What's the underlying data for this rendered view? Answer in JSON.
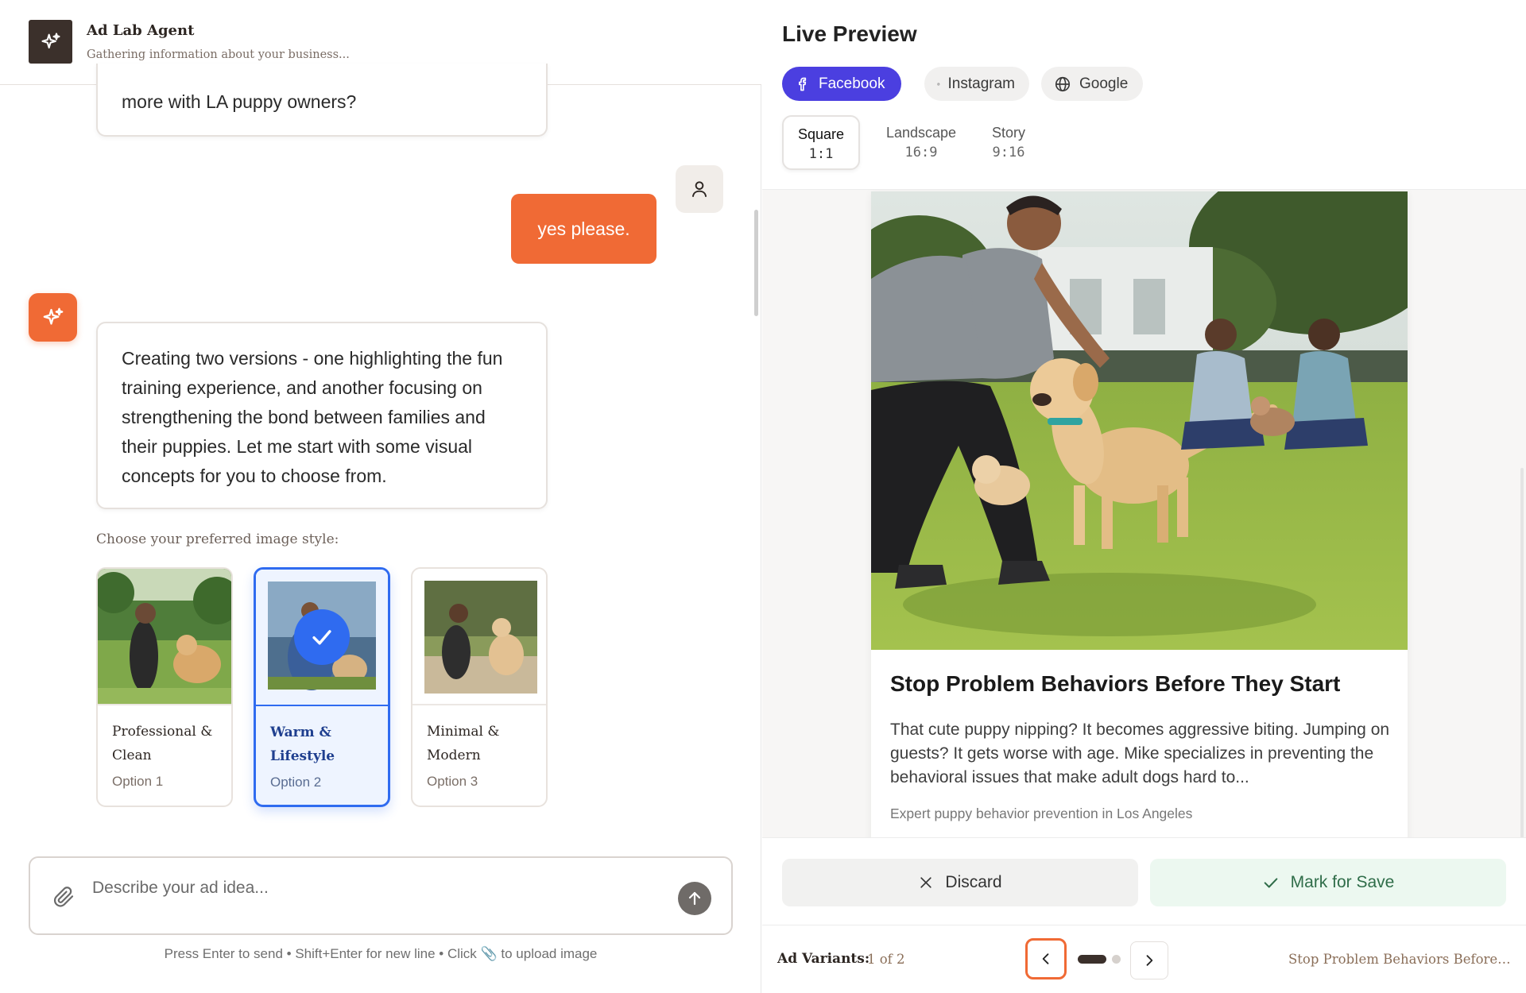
{
  "agent": {
    "name": "Ad Lab Agent",
    "status": "Gathering information about your business..."
  },
  "chat": {
    "messages": [
      {
        "role": "assistant",
        "text": "more with LA puppy owners?"
      },
      {
        "role": "user",
        "text": "yes please."
      },
      {
        "role": "assistant",
        "text": "Creating two versions - one highlighting the fun training experience, and another focusing on strengthening the bond between families and their puppies. Let me start with some visual concepts for you to choose from."
      }
    ],
    "style_prompt": "Choose your preferred image style:",
    "style_options": [
      {
        "title": "Professional & Clean",
        "subtitle": "Option 1",
        "selected": false
      },
      {
        "title": "Warm & Lifestyle",
        "subtitle": "Option 2",
        "selected": true
      },
      {
        "title": "Minimal & Modern",
        "subtitle": "Option 3",
        "selected": false
      }
    ]
  },
  "composer": {
    "placeholder": "Describe your ad idea...",
    "hint": "Press Enter to send • Shift+Enter for new line • Click 📎 to upload image"
  },
  "preview": {
    "title": "Live Preview",
    "platforms": [
      {
        "label": "Facebook",
        "icon": "facebook-icon",
        "active": true
      },
      {
        "label": "Instagram",
        "icon": "instagram-icon",
        "active": false
      },
      {
        "label": "Google",
        "icon": "globe-icon",
        "active": false
      }
    ],
    "formats": [
      {
        "name": "Square",
        "ratio": "1:1",
        "active": true
      },
      {
        "name": "Landscape",
        "ratio": "16:9",
        "active": false
      },
      {
        "name": "Story",
        "ratio": "9:16",
        "active": false
      }
    ],
    "ad": {
      "headline": "Stop Problem Behaviors Before They Start",
      "body": "That cute puppy nipping? It becomes aggressive biting. Jumping on guests? It gets worse with age. Mike specializes in preventing the behavioral issues that make adult dogs hard to...",
      "footer": "Expert puppy behavior prevention in Los Angeles"
    }
  },
  "actions": {
    "discard": "Discard",
    "save": "Mark for Save"
  },
  "variants": {
    "label": "Ad Variants:",
    "count": "1 of 2",
    "current_title": "Stop Problem Behaviors Before ..."
  },
  "colors": {
    "accent_orange": "#f06a35",
    "facebook_active": "#4b3fe0",
    "selected_blue": "#2f6bf0",
    "brand_dark": "#3b302b"
  }
}
